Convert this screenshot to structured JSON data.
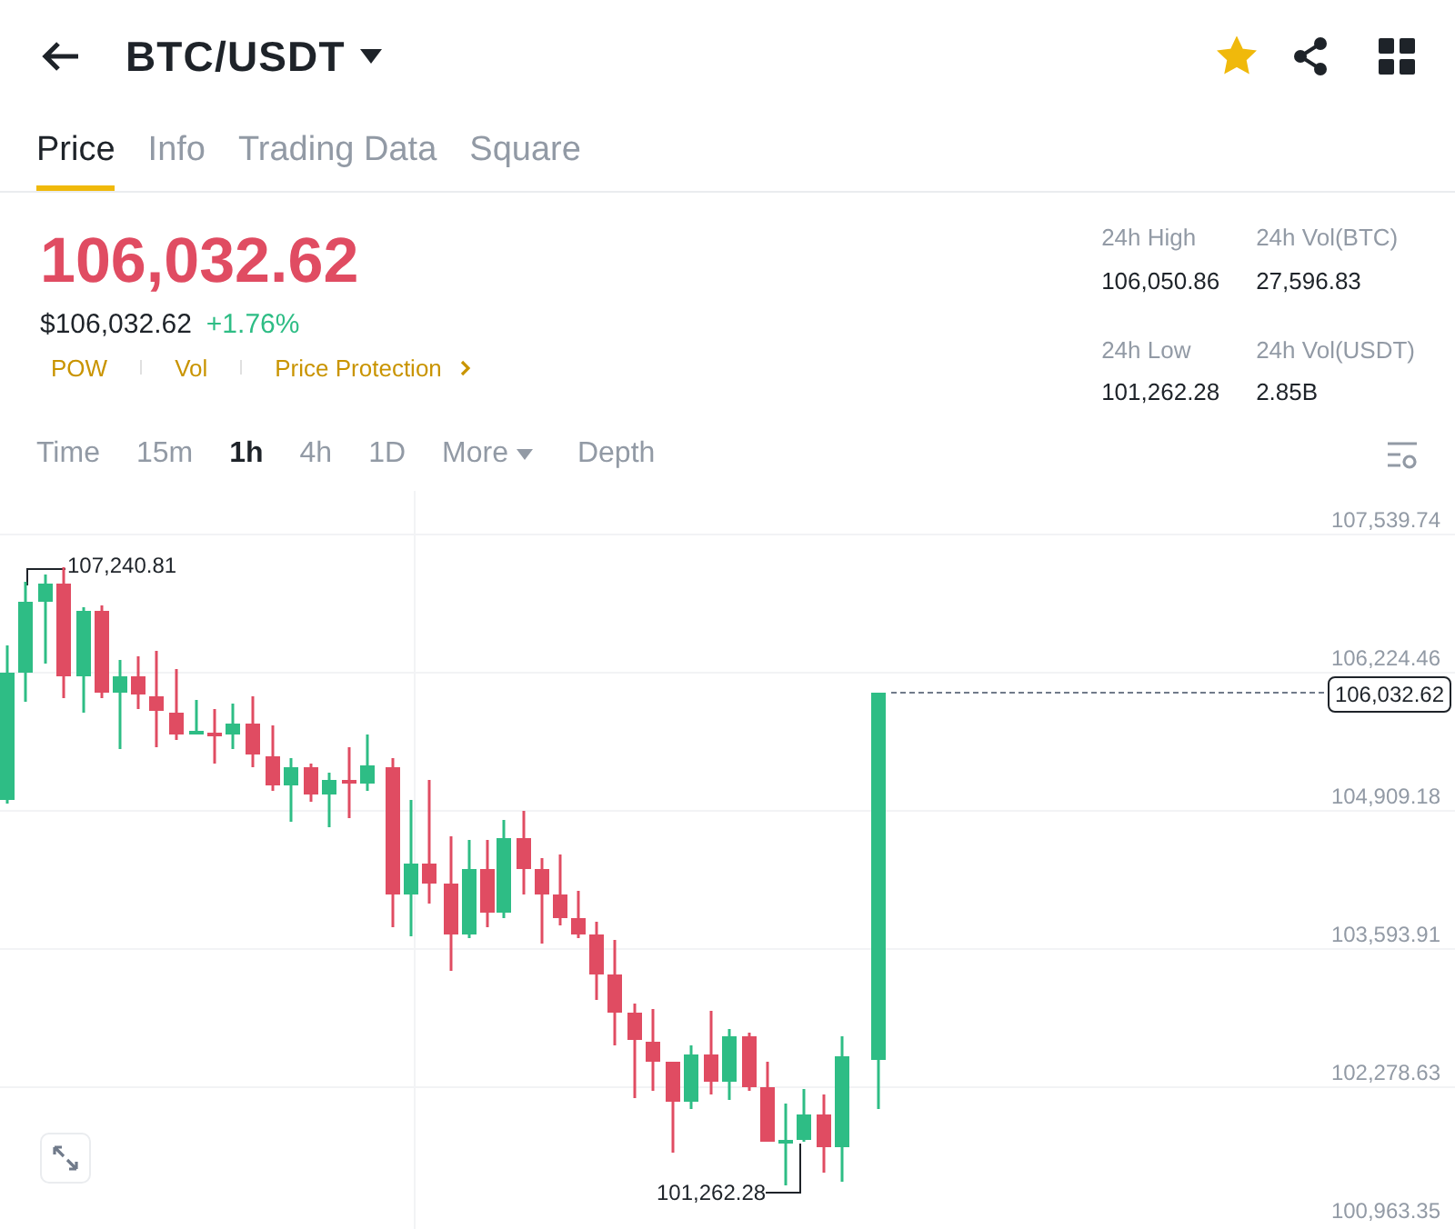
{
  "header": {
    "title": "BTC/USDT",
    "favorite": true
  },
  "tabs": [
    {
      "label": "Price",
      "selected": true
    },
    {
      "label": "Info",
      "selected": false
    },
    {
      "label": "Trading Data",
      "selected": false
    },
    {
      "label": "Square",
      "selected": false
    }
  ],
  "price": {
    "last": "106,032.62",
    "usd": "$106,032.62",
    "change": "+1.76%",
    "tags": [
      "POW",
      "Vol",
      "Price Protection"
    ]
  },
  "stats": [
    {
      "label": "24h High",
      "value": "106,050.86"
    },
    {
      "label": "24h Vol(BTC)",
      "value": "27,596.83"
    },
    {
      "label": "24h Low",
      "value": "101,262.28"
    },
    {
      "label": "24h Vol(USDT)",
      "value": "2.85B"
    }
  ],
  "intervals": [
    {
      "label": "Time",
      "kind": "interval",
      "selected": false
    },
    {
      "label": "15m",
      "kind": "interval",
      "selected": false
    },
    {
      "label": "1h",
      "kind": "interval",
      "selected": true
    },
    {
      "label": "4h",
      "kind": "interval",
      "selected": false
    },
    {
      "label": "1D",
      "kind": "interval",
      "selected": false
    },
    {
      "label": "More",
      "kind": "dropdown",
      "selected": false
    },
    {
      "label": "Depth",
      "kind": "interval",
      "selected": false
    }
  ],
  "chart": {
    "y_axis": [
      "107,539.74",
      "106,224.46",
      "104,909.18",
      "103,593.91",
      "102,278.63",
      "100,963.35"
    ],
    "high_label": "107,240.81",
    "low_label": "101,262.28",
    "current_price": "106,032.62"
  }
}
